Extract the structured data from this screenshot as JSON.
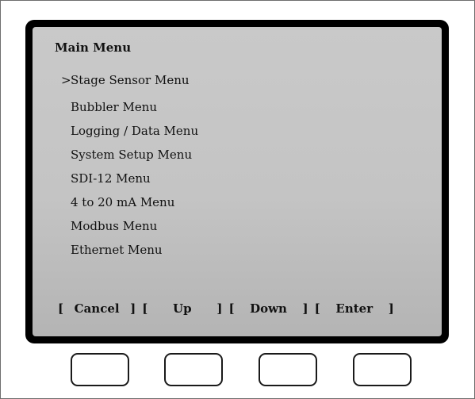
{
  "screen": {
    "title": "Main Menu",
    "cursor": ">",
    "items": [
      {
        "label": "Stage Sensor Menu",
        "selected": true
      },
      {
        "label": "Bubbler Menu",
        "selected": false
      },
      {
        "label": "Logging / Data Menu",
        "selected": false
      },
      {
        "label": "System Setup Menu",
        "selected": false
      },
      {
        "label": "SDI-12 Menu",
        "selected": false
      },
      {
        "label": "4 to 20 mA Menu",
        "selected": false
      },
      {
        "label": "Modbus Menu",
        "selected": false
      },
      {
        "label": "Ethernet Menu",
        "selected": false
      }
    ]
  },
  "softkeys": {
    "open": "[",
    "close": "]",
    "labels": [
      "Cancel",
      "Up",
      "Down",
      "Enter"
    ]
  },
  "colors": {
    "bezel": "#000000",
    "screen": "#c4c4c4",
    "text": "#111111",
    "button_border": "#1a1a1a"
  }
}
